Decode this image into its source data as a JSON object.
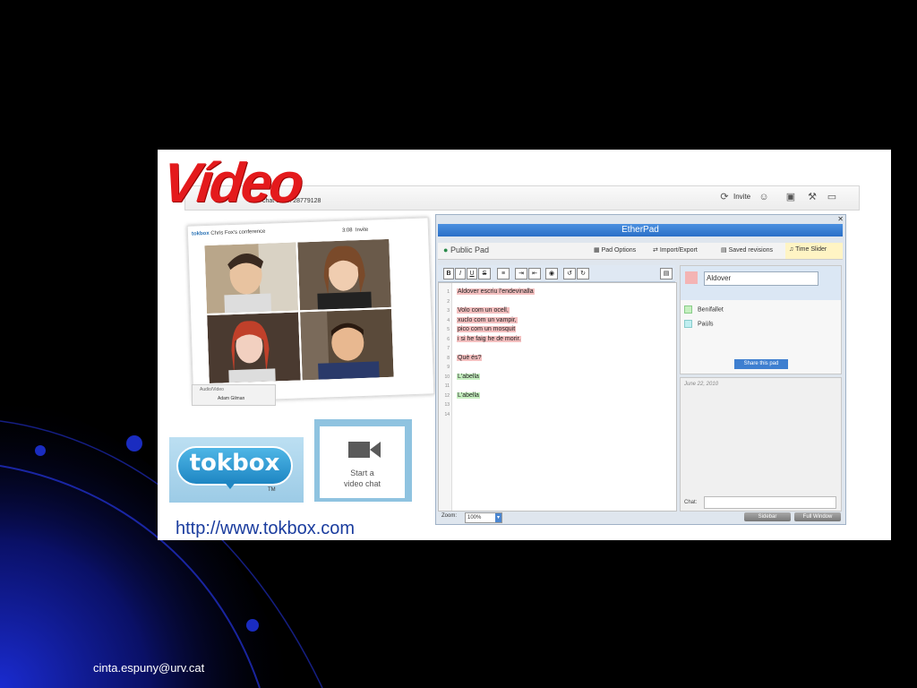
{
  "slide": {
    "title": "Vídeo",
    "footer_email": "cinta.espuny@urv.cat",
    "url": "http://www.tokbox.com"
  },
  "tokbox_app": {
    "chat_code_text": "chat code: 28779128",
    "invite_label": "Invite",
    "conference_brand": "tokbox",
    "conference_title": "Chris Fox's conference",
    "conference_invite": "Invite",
    "conference_time": "3:08",
    "audio_video_label": "Audio/Video",
    "participant_name": "Adam Gilman"
  },
  "logo": {
    "word": "tokbox",
    "tm": "TM"
  },
  "start_chat": {
    "line1": "Start a",
    "line2": "video chat"
  },
  "etherpad": {
    "title": "EtherPad",
    "public_pad": "Public Pad",
    "menu": [
      "Pad Options",
      "Import/Export",
      "Saved revisions",
      "Time Slider"
    ],
    "lines": [
      {
        "n": "1",
        "text": "Aldover escriu l'endevinalla",
        "hl": "red"
      },
      {
        "n": "2",
        "text": "",
        "hl": ""
      },
      {
        "n": "3",
        "text": "Volo com un ocell,",
        "hl": "red"
      },
      {
        "n": "4",
        "text": "xuclo com un vampir,",
        "hl": "red"
      },
      {
        "n": "5",
        "text": "pico com un mosquit",
        "hl": "red"
      },
      {
        "n": "6",
        "text": "i si he faig he de morir.",
        "hl": "red"
      },
      {
        "n": "7",
        "text": "",
        "hl": ""
      },
      {
        "n": "8",
        "text": "Què és?",
        "hl": "red"
      },
      {
        "n": "9",
        "text": "",
        "hl": ""
      },
      {
        "n": "10",
        "text": "L'abella",
        "hl": "green"
      },
      {
        "n": "11",
        "text": "",
        "hl": ""
      },
      {
        "n": "12",
        "text": "L'abella",
        "hl": "green"
      },
      {
        "n": "13",
        "text": "",
        "hl": ""
      },
      {
        "n": "14",
        "text": "",
        "hl": ""
      }
    ],
    "me_name": "Aldover",
    "users": [
      {
        "name": "Benifallet",
        "color": "#c6f0c0"
      },
      {
        "name": "Paüls",
        "color": "#c0eef0"
      }
    ],
    "share_label": "Share this pad",
    "chat_date": "June 22, 2010",
    "chat_label": "Chat:",
    "zoom_label": "Zoom:",
    "zoom_value": "100%",
    "sidebar_btn": "Sidebar",
    "fullwindow_btn": "Full Window"
  }
}
